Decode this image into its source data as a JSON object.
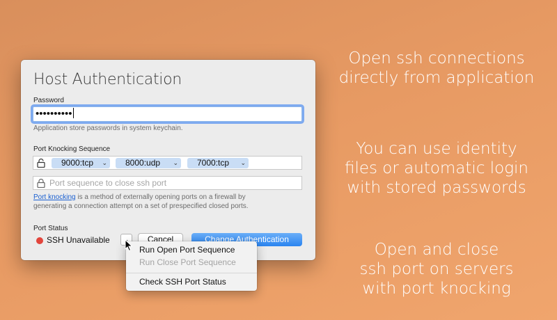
{
  "dialog": {
    "title": "Host Authentication",
    "password": {
      "label": "Password",
      "value": "••••••••••",
      "hint": "Application store passwords in system keychain."
    },
    "port_knocking": {
      "label": "Port Knocking Sequence",
      "open_sequence": [
        "9000:tcp",
        "8000:udp",
        "7000:tcp"
      ],
      "close_placeholder": "Port sequence to close ssh port",
      "desc_link": "Port knocking",
      "desc_line1_rest": " is a method of externally opening ports on a firewall by",
      "desc_line2": "generating a connection attempt on a set of prespecified closed ports."
    },
    "port_status": {
      "label": "Port Status",
      "status": "SSH Unavailable",
      "status_color": "#e2453c"
    },
    "buttons": {
      "cancel": "Cancel",
      "primary": "Change Authentication"
    }
  },
  "menu": {
    "items": [
      {
        "label": "Run Open Port Sequence",
        "enabled": true
      },
      {
        "label": "Run Close Port Sequence",
        "enabled": false
      },
      {
        "label": "Check SSH Port Status",
        "enabled": true
      }
    ]
  },
  "captions": [
    {
      "line1": "Open ssh connections",
      "line2": "directly from application"
    },
    {
      "line1": "You can use identity",
      "line2": "files or automatic login",
      "line3": "with stored passwords"
    },
    {
      "line1": "Open and close",
      "line2": "ssh port on servers",
      "line3": "with port knocking"
    }
  ],
  "colors": {
    "accent": "#2a84f0",
    "token": "#c9ddf5",
    "link": "#1a5fd0"
  },
  "icons": [
    "unlocked-lock-icon",
    "lock-icon",
    "chevron-down-icon",
    "mouse-pointer-icon"
  ]
}
